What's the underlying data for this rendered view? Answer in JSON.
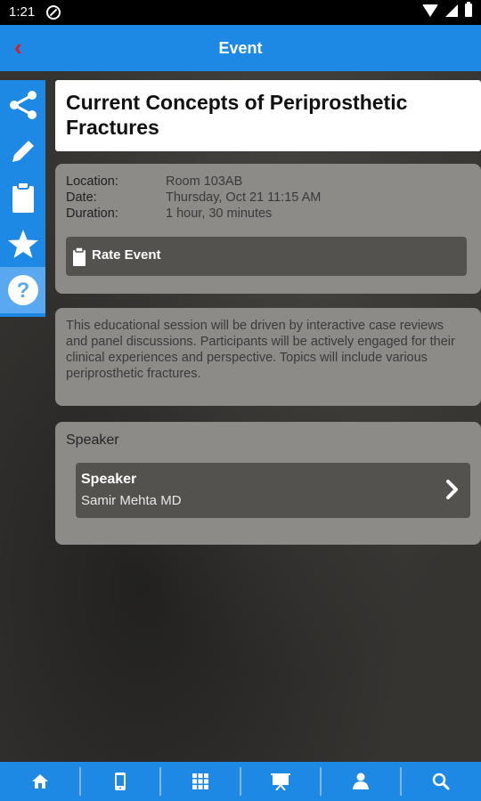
{
  "status_bar": {
    "time": "1:21"
  },
  "app_bar": {
    "title": "Event"
  },
  "sidebar": {
    "items": [
      {
        "name": "share",
        "icon": "share-icon"
      },
      {
        "name": "edit",
        "icon": "pencil-icon"
      },
      {
        "name": "clipboard",
        "icon": "clipboard-icon"
      },
      {
        "name": "favorite",
        "icon": "star-icon"
      },
      {
        "name": "help",
        "icon": "question-icon"
      }
    ]
  },
  "event": {
    "title": "Current Concepts of Periprosthetic Fractures",
    "location_label": "Location:",
    "location": "Room 103AB",
    "date_label": "Date:",
    "date": "Thursday, Oct 21 11:15 AM",
    "duration_label": "Duration:",
    "duration": "1 hour, 30 minutes",
    "rate_label": "Rate Event",
    "description": "This educational session will be driven by interactive case reviews and panel discussions. Participants will be actively engaged for their clinical experiences and perspective. Topics will include various periprosthetic fractures."
  },
  "speaker_section": {
    "heading": "Speaker",
    "role": "Speaker",
    "name": "Samir Mehta MD"
  },
  "bottom_nav": {
    "items": [
      {
        "icon": "home-icon"
      },
      {
        "icon": "phone-icon"
      },
      {
        "icon": "grid-icon"
      },
      {
        "icon": "presentation-icon"
      },
      {
        "icon": "person-icon"
      },
      {
        "icon": "search-icon"
      }
    ]
  },
  "colors": {
    "accent": "#1e88e5",
    "back_arrow": "#e8161b",
    "card": "#8d8b88",
    "card_dark": "#54524f"
  }
}
